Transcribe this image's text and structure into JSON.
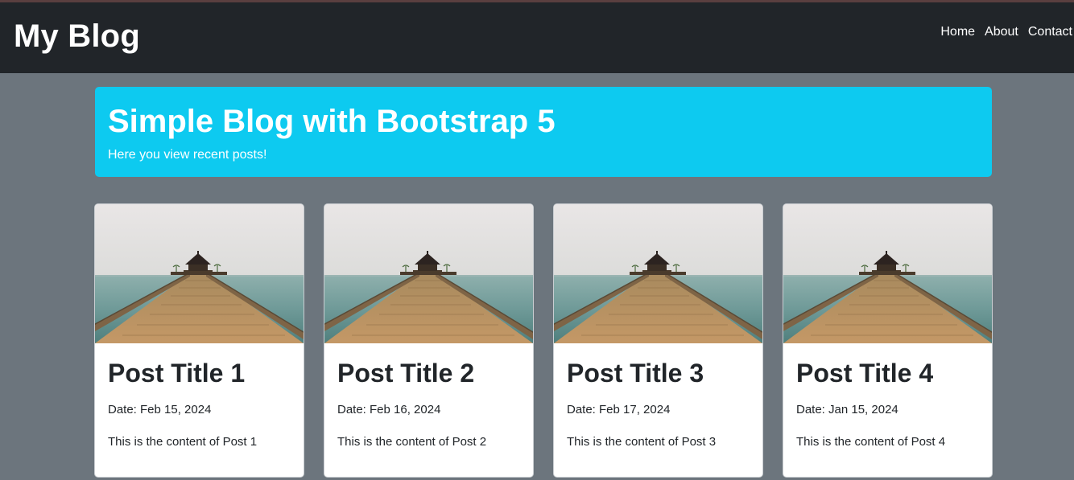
{
  "navbar": {
    "brand": "My Blog",
    "links": [
      "Home",
      "About",
      "Contact"
    ],
    "background": "#212529"
  },
  "hero": {
    "title": "Simple Blog with Bootstrap 5",
    "subtitle": "Here you view recent posts!",
    "background": "#0dcaf0"
  },
  "posts": [
    {
      "title": "Post Title 1",
      "date": "Date: Feb 15, 2024",
      "content": "This is the content of Post 1",
      "image": "pier-photo"
    },
    {
      "title": "Post Title 2",
      "date": "Date: Feb 16, 2024",
      "content": "This is the content of Post 2",
      "image": "pier-photo"
    },
    {
      "title": "Post Title 3",
      "date": "Date: Feb 17, 2024",
      "content": "This is the content of Post 3",
      "image": "pier-photo"
    },
    {
      "title": "Post Title 4",
      "date": "Date: Jan 15, 2024",
      "content": "This is the content of Post 4",
      "image": "pier-photo"
    }
  ],
  "page_background": "#6c757d"
}
